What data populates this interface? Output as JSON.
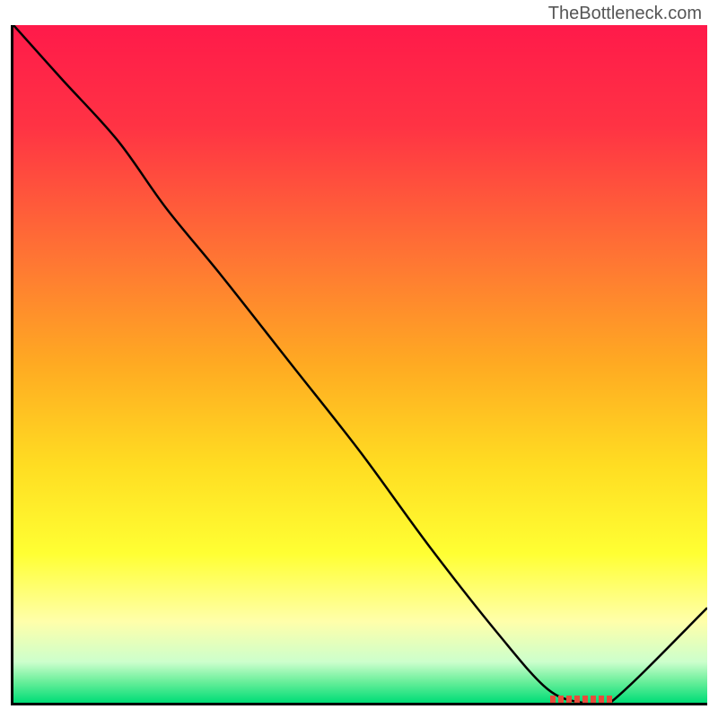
{
  "watermark": "TheBottleneck.com",
  "chart_data": {
    "type": "line",
    "title": "",
    "xlabel": "",
    "ylabel": "",
    "xlim": [
      0,
      100
    ],
    "ylim": [
      0,
      100
    ],
    "series": [
      {
        "name": "bottleneck-curve",
        "x": [
          0,
          7,
          15,
          22,
          30,
          40,
          50,
          60,
          70,
          77,
          82,
          86,
          100
        ],
        "y": [
          100,
          92,
          83,
          73,
          63,
          50,
          37,
          23,
          10,
          2,
          0,
          0,
          14
        ]
      }
    ],
    "optimal_zone": {
      "x_start": 77,
      "x_end": 86,
      "y": 0
    },
    "gradient_stops": [
      {
        "offset": 0,
        "color": "#ff1a4a"
      },
      {
        "offset": 15,
        "color": "#ff3344"
      },
      {
        "offset": 35,
        "color": "#ff7733"
      },
      {
        "offset": 50,
        "color": "#ffaa22"
      },
      {
        "offset": 65,
        "color": "#ffdd22"
      },
      {
        "offset": 78,
        "color": "#ffff33"
      },
      {
        "offset": 88,
        "color": "#ffffaa"
      },
      {
        "offset": 94,
        "color": "#ccffcc"
      },
      {
        "offset": 97,
        "color": "#66ee99"
      },
      {
        "offset": 100,
        "color": "#00dd77"
      }
    ]
  }
}
